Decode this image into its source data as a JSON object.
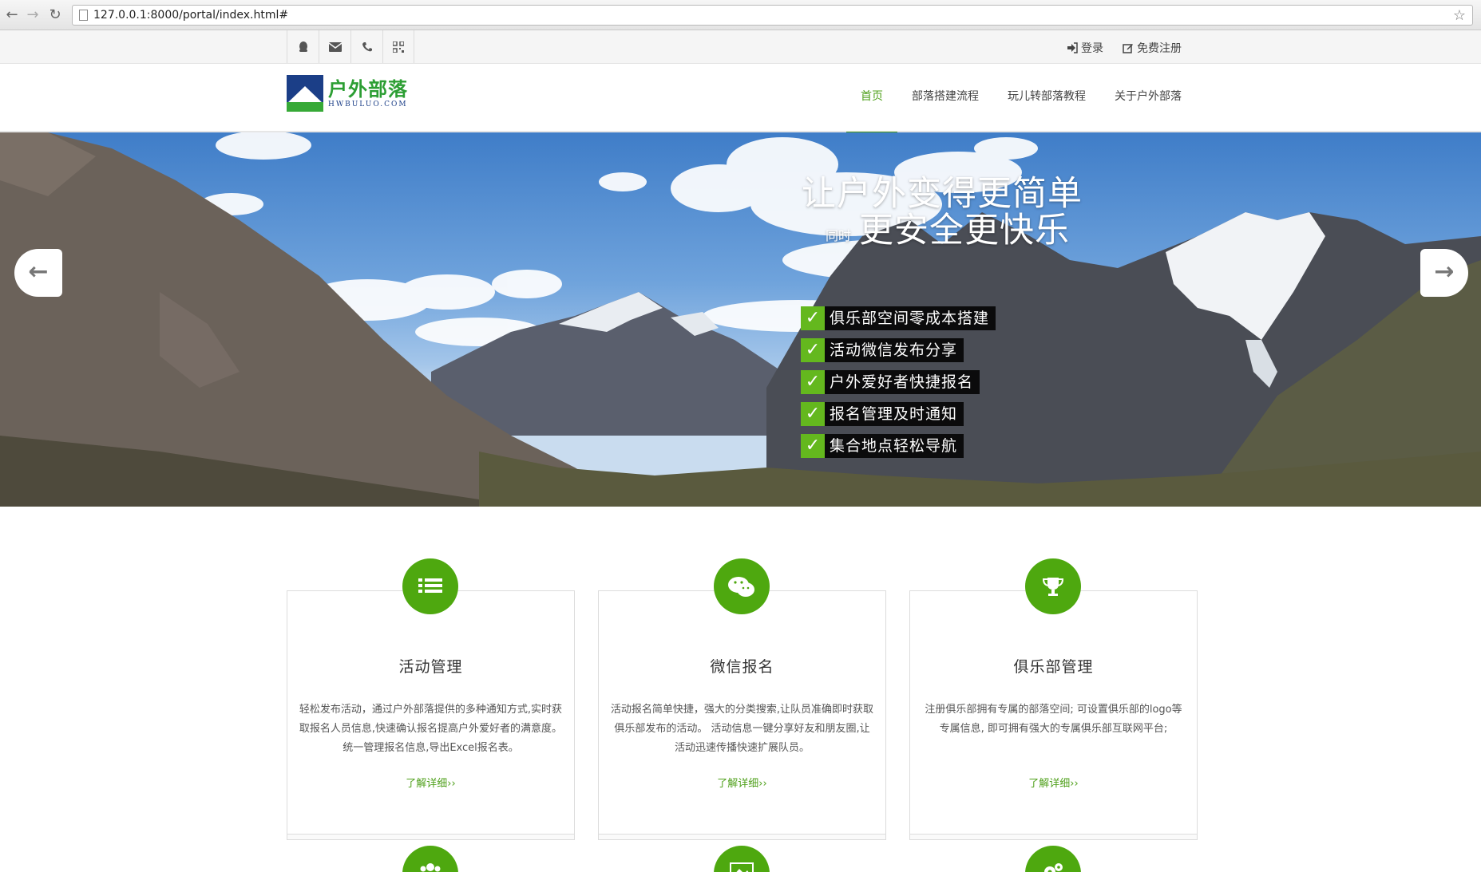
{
  "browser": {
    "url": "127.0.0.1:8000/portal/index.html#",
    "icons": [
      "back-arrow-icon",
      "forward-arrow-icon",
      "reload-icon",
      "page-icon",
      "star-icon"
    ]
  },
  "topbar": {
    "icons": [
      "qq-icon",
      "mail-icon",
      "phone-icon",
      "qrcode-icon"
    ],
    "login_label": "登录",
    "register_label": "免费注册"
  },
  "header": {
    "logo_title": "户外部落",
    "logo_subtitle": "HWBULUO.COM",
    "nav": [
      {
        "label": "首页",
        "active": true
      },
      {
        "label": "部落搭建流程",
        "active": false
      },
      {
        "label": "玩儿转部落教程",
        "active": false
      },
      {
        "label": "关于户外部落",
        "active": false
      }
    ]
  },
  "banner": {
    "slogan_line1": "让户外变得更简单",
    "slogan_small": "同时",
    "slogan_line2": "更安全更快乐",
    "features": [
      "俱乐部空间零成本搭建",
      "活动微信发布分享",
      "户外爱好者快捷报名",
      "报名管理及时通知",
      "集合地点轻松导航"
    ]
  },
  "cards": [
    {
      "icon": "list-icon",
      "title": "活动管理",
      "description": "轻松发布活动，通过户外部落提供的多种通知方式,实时获取报名人员信息,快速确认报名提高户外爱好者的满意度。 统一管理报名信息,导出Excel报名表。",
      "link": "了解详细››"
    },
    {
      "icon": "wechat-icon",
      "title": "微信报名",
      "description": "活动报名简单快捷，强大的分类搜索,让队员准确即时获取俱乐部发布的活动。 活动信息一键分享好友和朋友圈,让活动迅速传播快速扩展队员。",
      "link": "了解详细››"
    },
    {
      "icon": "trophy-icon",
      "title": "俱乐部管理",
      "description": "注册俱乐部拥有专属的部落空间; 可设置俱乐部的logo等专属信息, 即可拥有强大的专属俱乐部互联网平台;",
      "link": "了解详细››"
    }
  ],
  "row2_icons": [
    "users-icon",
    "image-icon",
    "gears-icon"
  ],
  "colors": {
    "accent": "#4ea80f",
    "brand_blue": "#1b3e87"
  }
}
